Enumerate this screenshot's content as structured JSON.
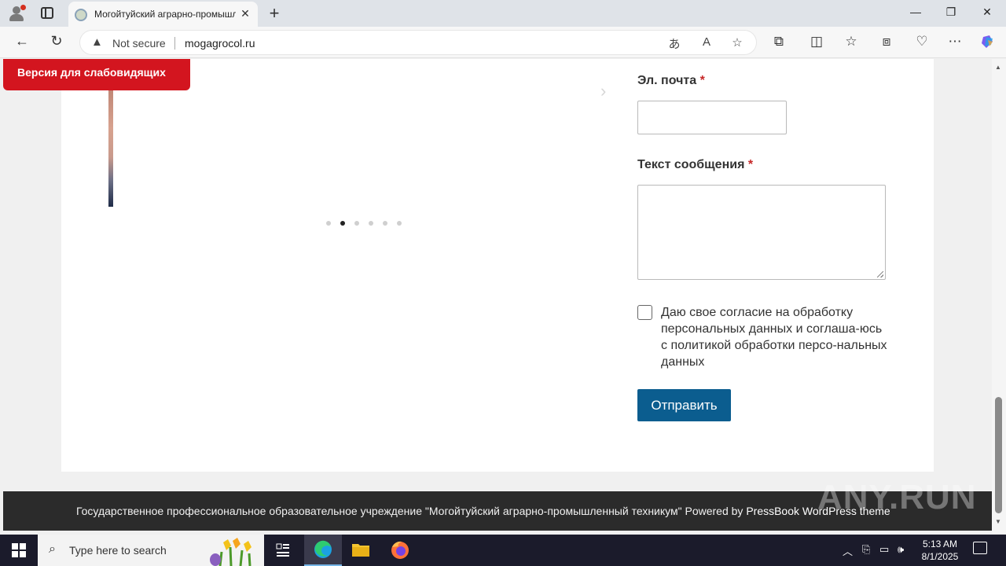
{
  "browser": {
    "tab_title": "Могойтуйский аграрно-промышленный техникум",
    "tab_close": "✕",
    "new_tab": "+",
    "security_label": "Not secure",
    "url": "mogagrocol.ru",
    "icons": [
      "profile-icon",
      "tabs-icon",
      "site-favicon",
      "back-icon",
      "refresh-icon",
      "warning-icon",
      "translate-icon",
      "read-aloud-icon",
      "favorite-star-icon",
      "extensions-icon",
      "split-screen-icon",
      "favorites-icon",
      "collections-icon",
      "browser-essentials-icon",
      "more-icon",
      "copilot-icon"
    ]
  },
  "page": {
    "low_vision_button": "Версия для слабовидящих",
    "slider": {
      "dot_count": 6,
      "active_dot": 1
    },
    "form": {
      "email_label": "Эл. почта",
      "message_label": "Текст сообщения",
      "required_mark": "*",
      "email_value": "",
      "message_value": "",
      "consent_checked": false,
      "consent_text": "Даю свое согласие на обработку персональных данных и соглаша-юсь с политикой обработки персо-нальных данных",
      "submit_label": "Отправить"
    },
    "footer": {
      "text": "Государственное профессиональное образовательное учреждение \"Могойтуйский аграрно-промышленный техникум\" Powered by ",
      "link": "PressBook WordPress theme"
    },
    "watermark": "ANY.RUN"
  },
  "taskbar": {
    "search_placeholder": "Type here to search",
    "time": "5:13 AM",
    "date": "8/1/2025"
  },
  "colors": {
    "accent_red": "#d3151f",
    "submit_blue": "#0b5d8f",
    "footer_bg": "#2b2b2b",
    "required_red": "#c62828"
  }
}
